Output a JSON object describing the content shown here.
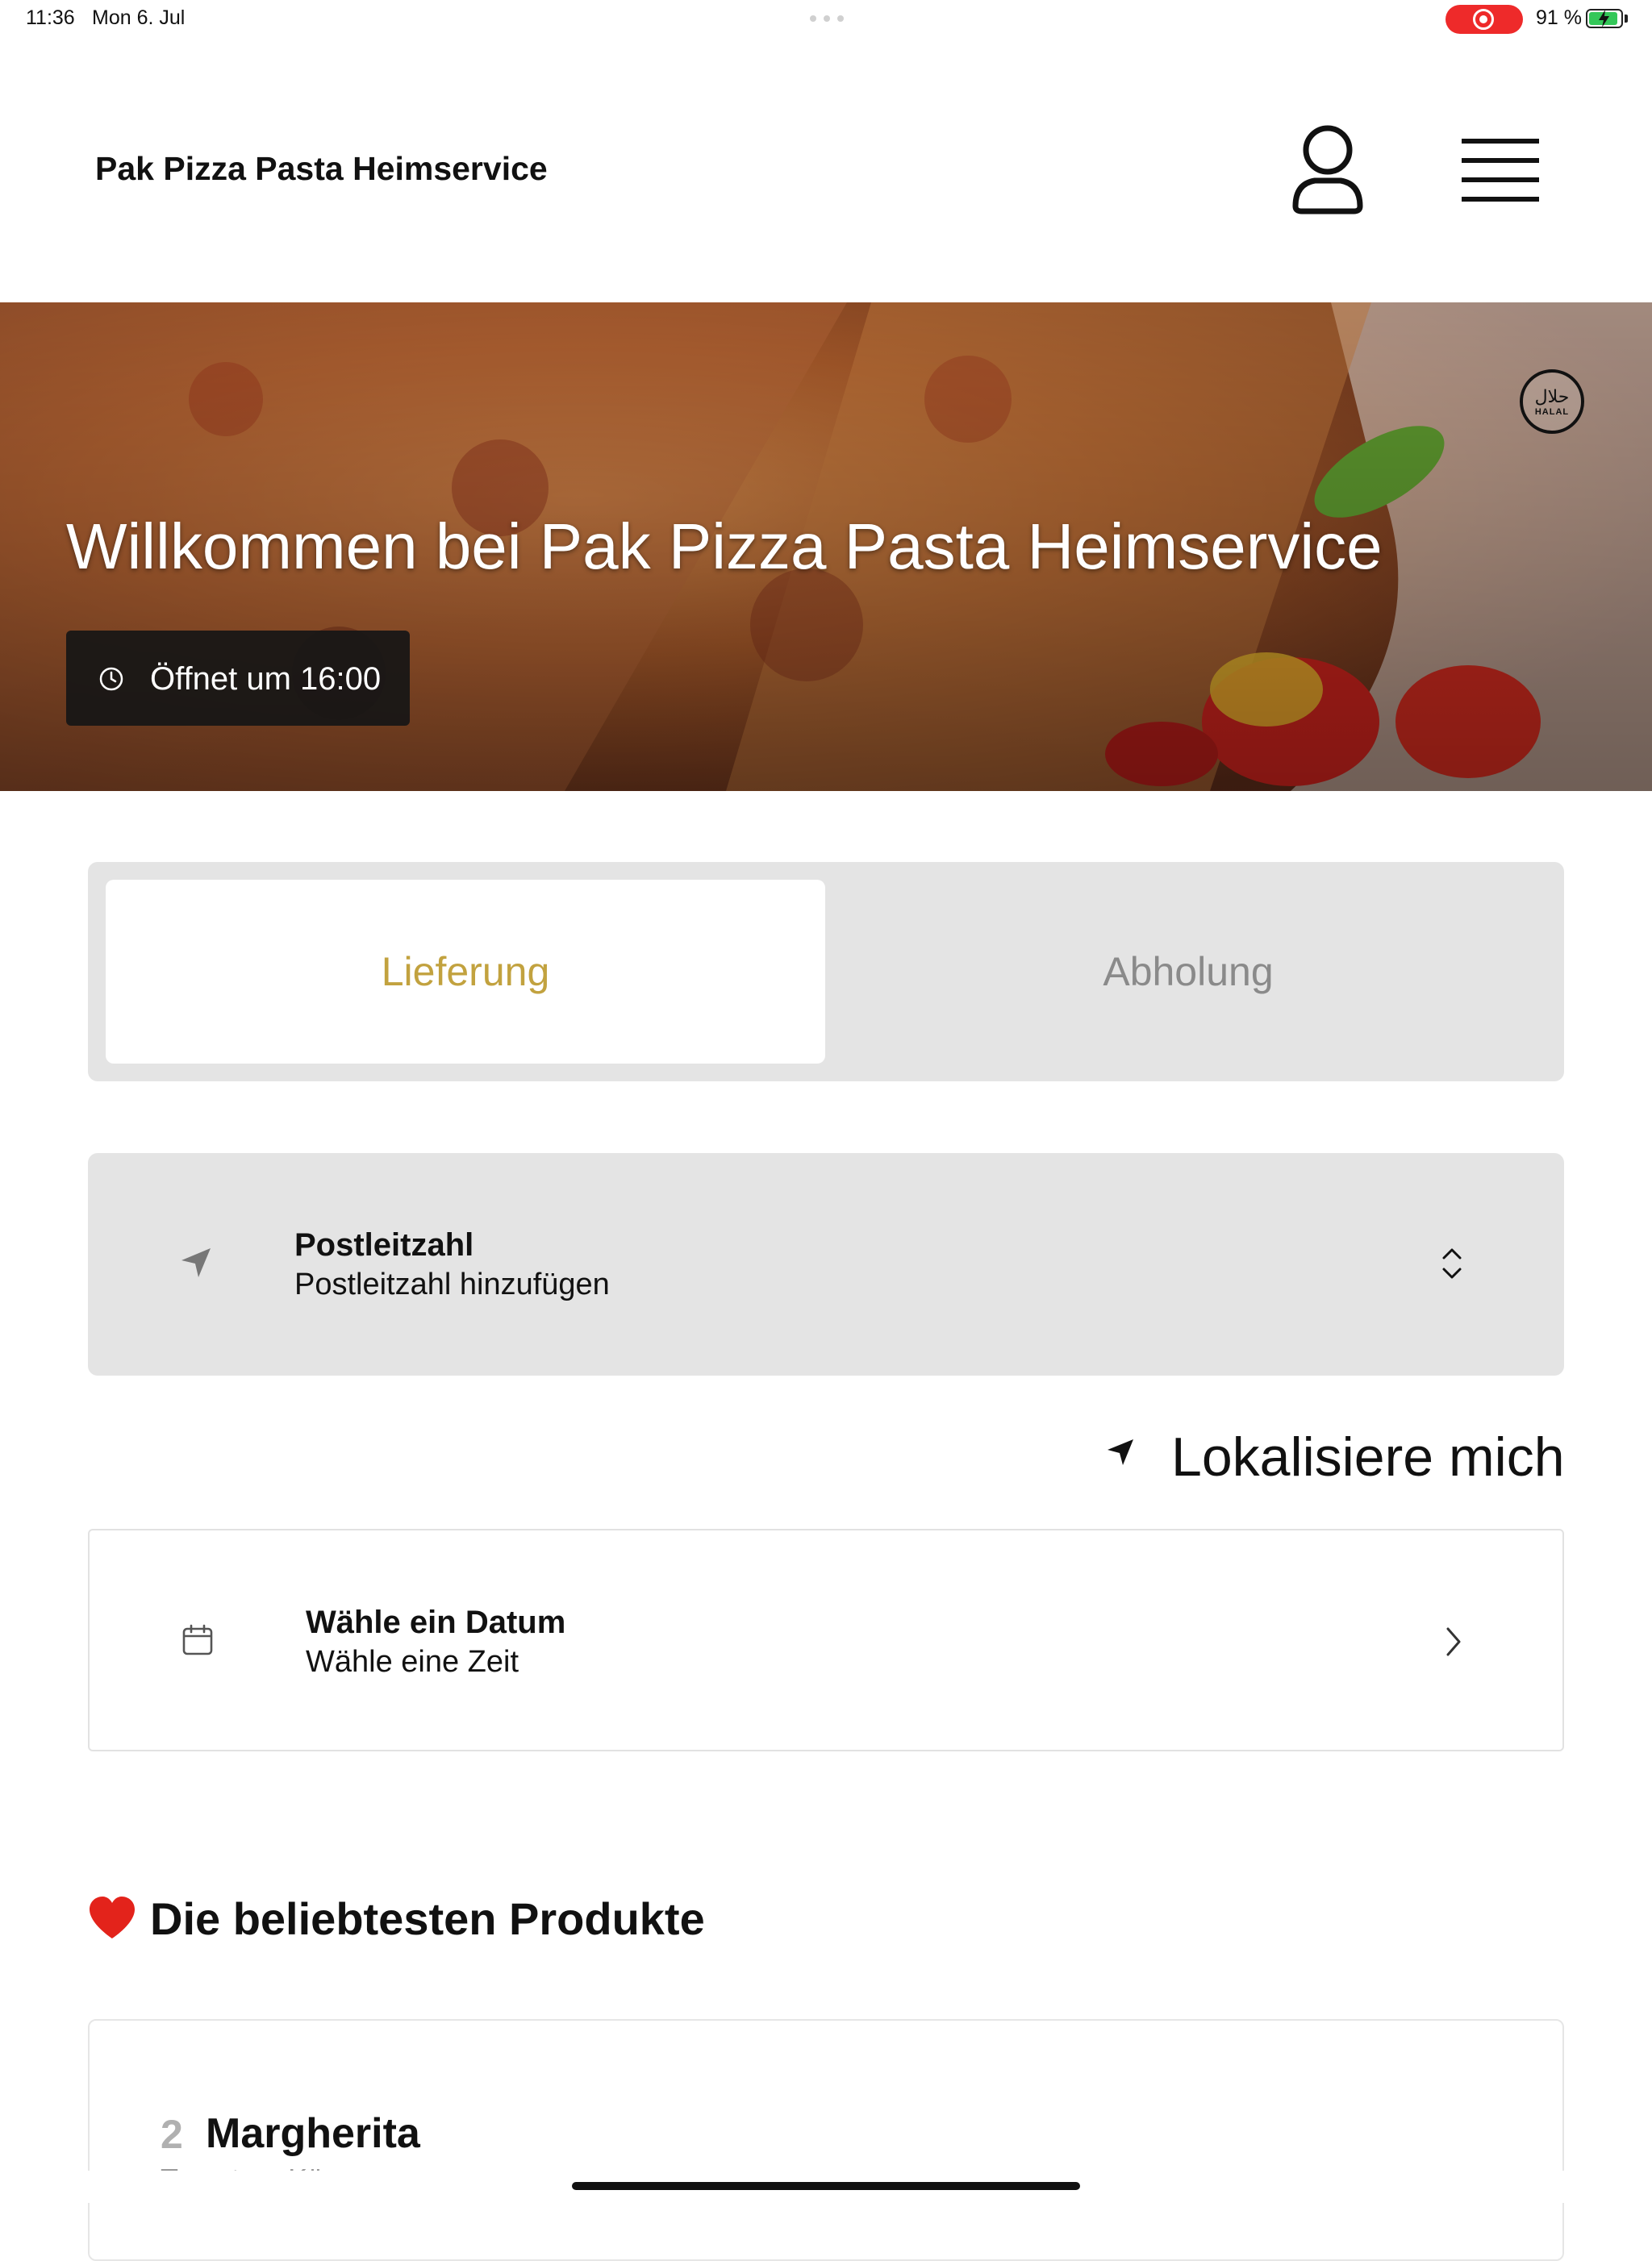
{
  "status_bar": {
    "time": "11:36",
    "date": "Mon 6. Jul",
    "battery_percent": "91 %",
    "battery_level": 0.91,
    "recording_color": "#ee2a2a",
    "battery_color": "#34c759"
  },
  "header": {
    "title": "Pak Pizza Pasta Heimservice",
    "account_icon": "user-icon",
    "menu_icon": "hamburger-menu-icon"
  },
  "hero": {
    "title": "Willkommen bei Pak Pizza Pasta Heimservice",
    "open_status": "Öffnet um 16:00",
    "badge_arabic": "حلال",
    "badge_latin": "HALAL"
  },
  "order_mode": {
    "options": [
      "Lieferung",
      "Abholung"
    ],
    "selected": "Lieferung",
    "accent_color": "#c2a23f"
  },
  "postal_code": {
    "label": "Postleitzahl",
    "placeholder": "Postleitzahl hinzufügen",
    "icon": "location-arrow-icon"
  },
  "locate": {
    "label": "Lokalisiere mich",
    "icon": "location-arrow-icon"
  },
  "schedule": {
    "title": "Wähle ein Datum",
    "subtitle": "Wähle eine Zeit",
    "icon": "calendar-icon"
  },
  "popular": {
    "title": "Die beliebtesten Produkte",
    "icon": "heart-icon",
    "products": [
      {
        "number": "2",
        "name": "Margherita",
        "description": "Tomaten, Käse"
      }
    ]
  }
}
